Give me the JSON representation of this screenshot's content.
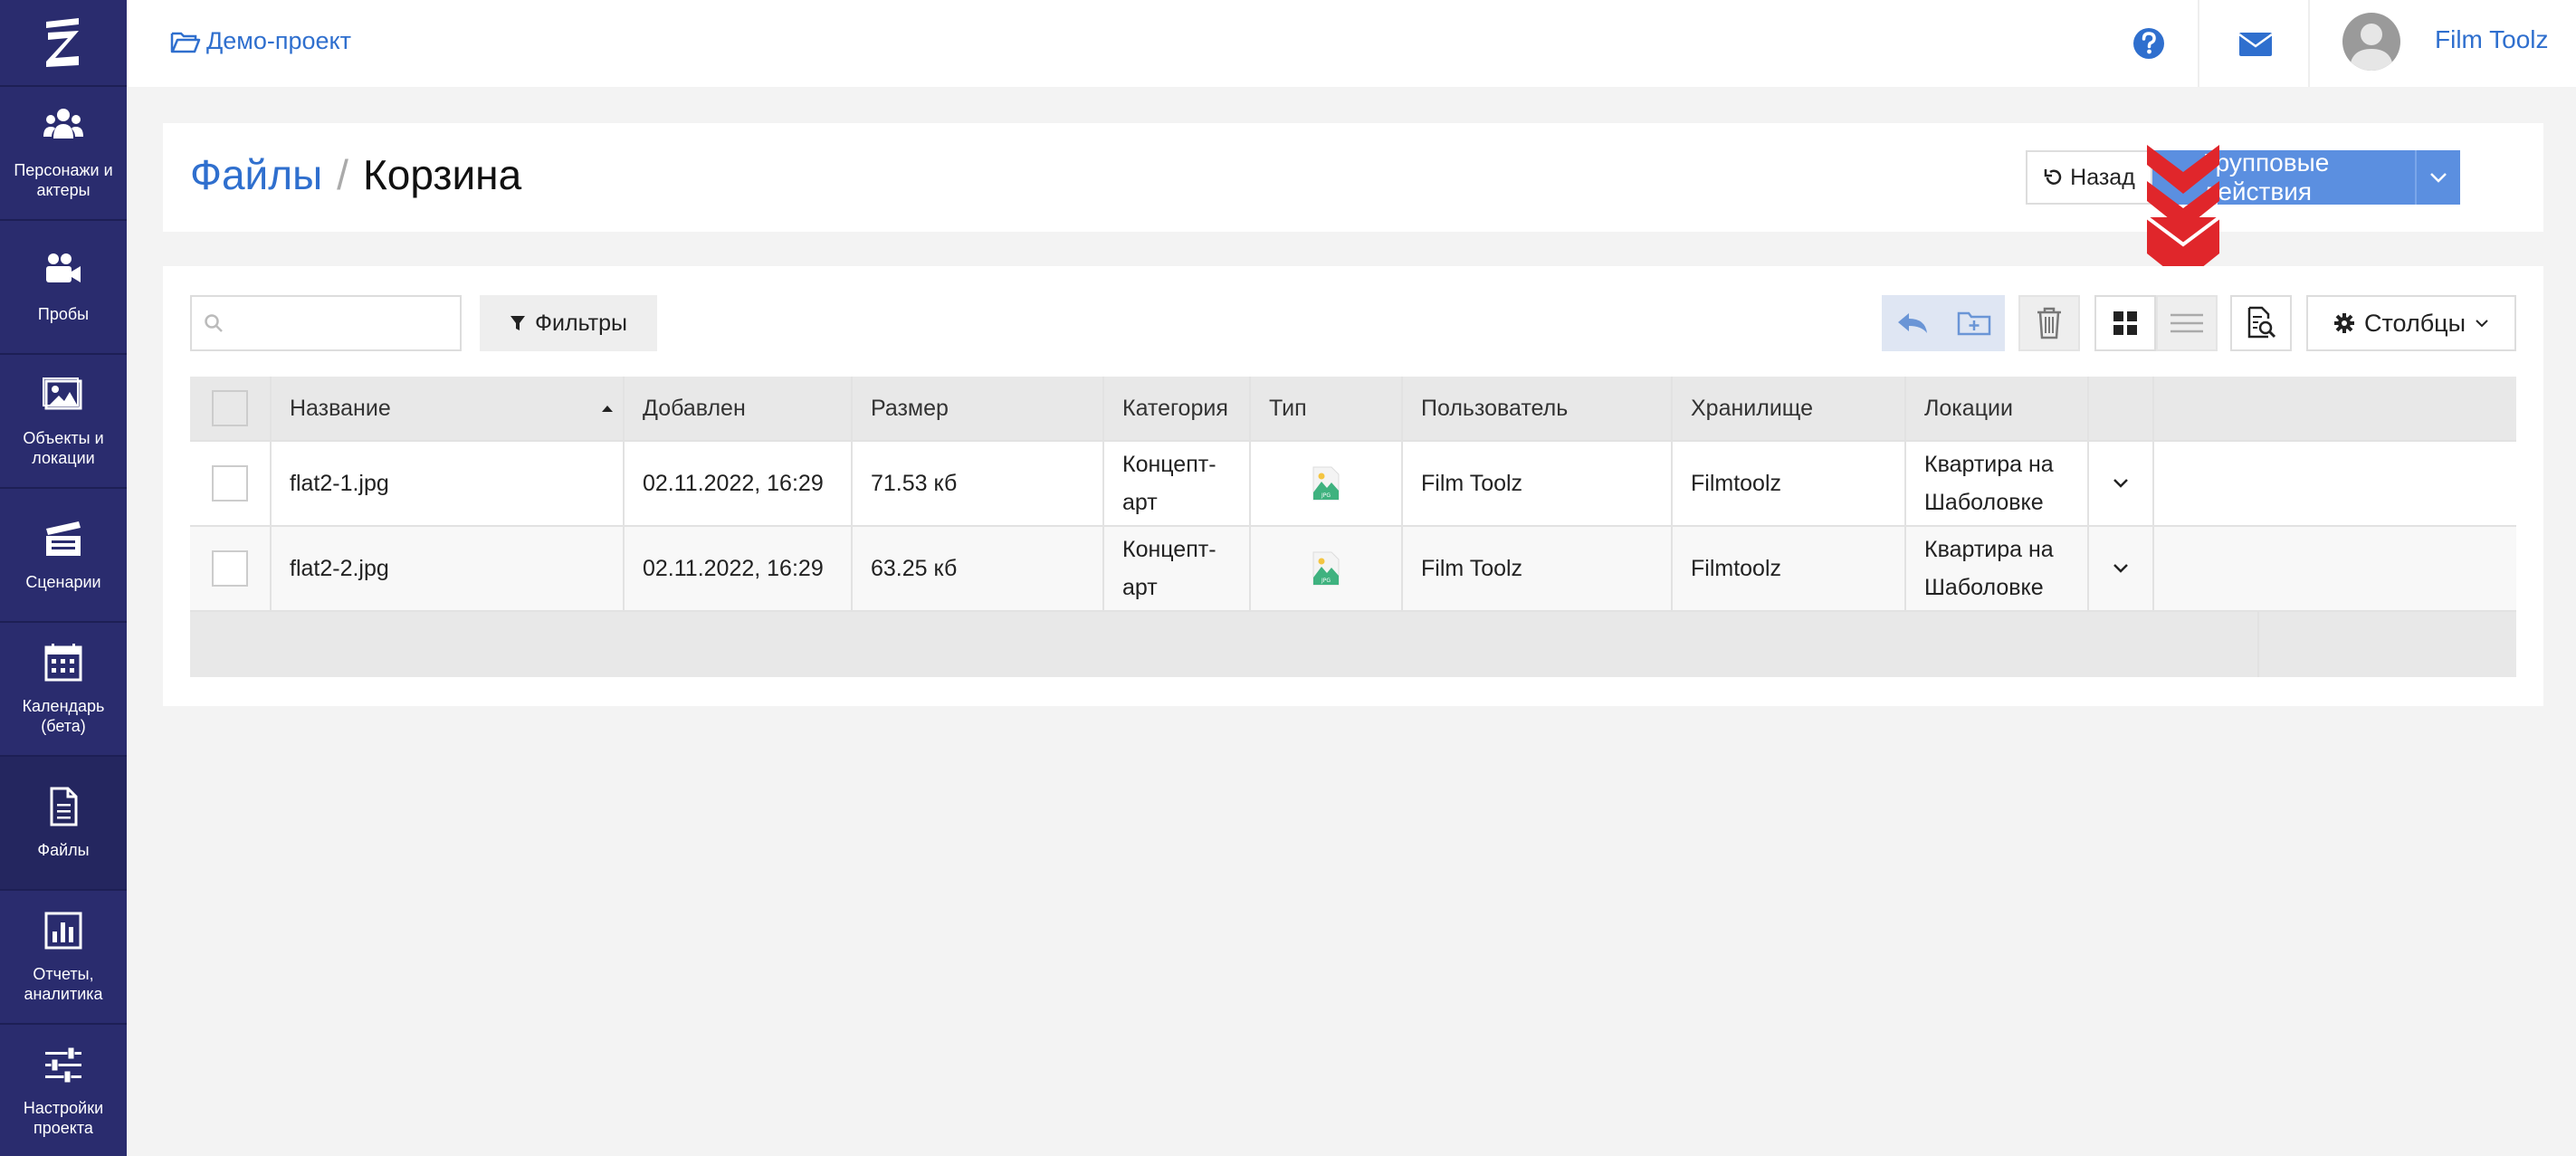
{
  "sidebar": {
    "items": [
      {
        "label": "Персонажи и актеры",
        "icon": "users-icon"
      },
      {
        "label": "Пробы",
        "icon": "video-camera-icon"
      },
      {
        "label": "Объекты и локации",
        "icon": "image-icon"
      },
      {
        "label": "Сценарии",
        "icon": "clapperboard-icon"
      },
      {
        "label": "Календарь (бета)",
        "icon": "calendar-icon"
      },
      {
        "label": "Файлы",
        "icon": "file-icon"
      },
      {
        "label": "Отчеты, аналитика",
        "icon": "chart-icon"
      },
      {
        "label": "Настройки проекта",
        "icon": "sliders-icon"
      }
    ]
  },
  "topbar": {
    "project": "Демо-проект",
    "user": "Film Toolz"
  },
  "header": {
    "breadcrumb_parent": "Файлы",
    "breadcrumb_sep": "/",
    "breadcrumb_current": "Корзина",
    "back_label": "Назад",
    "group_actions_label": "Групповые действия"
  },
  "toolbar": {
    "search_placeholder": "",
    "filters_label": "Фильтры",
    "columns_label": "Столбцы"
  },
  "table": {
    "columns": [
      "Название",
      "Добавлен",
      "Размер",
      "Категория",
      "Тип",
      "Пользователь",
      "Хранилище",
      "Локации"
    ],
    "rows": [
      {
        "name": "flat2-1.jpg",
        "added": "02.11.2022, 16:29",
        "size": "71.53 кб",
        "category": "Концепт-арт",
        "type": "JPG",
        "user": "Film Toolz",
        "storage": "Filmtoolz",
        "locations": "Квартира на Шаболовке"
      },
      {
        "name": "flat2-2.jpg",
        "added": "02.11.2022, 16:29",
        "size": "63.25 кб",
        "category": "Концепт-арт",
        "type": "JPG",
        "user": "Film Toolz",
        "storage": "Filmtoolz",
        "locations": "Квартира на Шаболовке"
      }
    ]
  },
  "colors": {
    "sidebar": "#2a2c6e",
    "accent": "#2f6fce",
    "group_button": "#5b8fe0",
    "marker": "#e0262b"
  }
}
